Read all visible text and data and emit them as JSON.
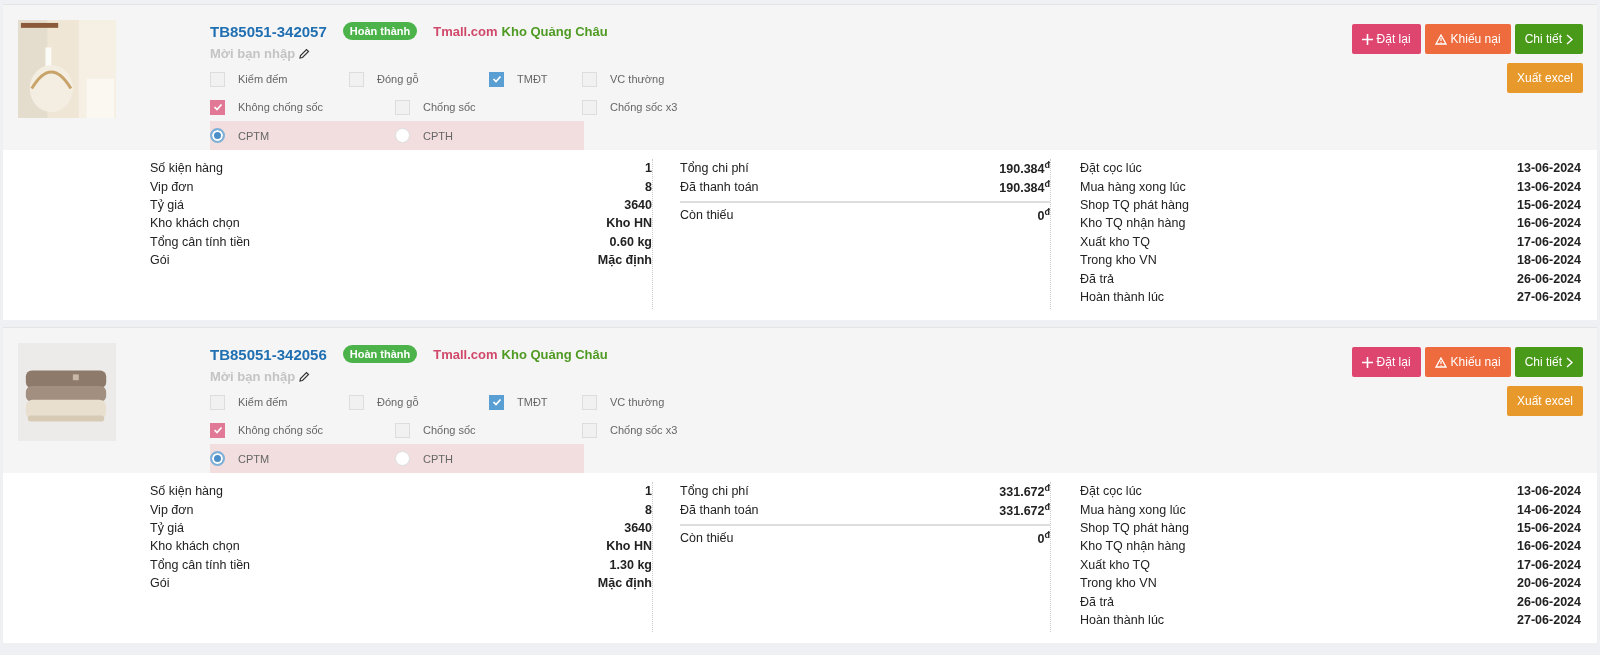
{
  "orders": [
    {
      "code": "TB85051-342057",
      "status": "Hoàn thành",
      "source": "Tmall.com",
      "warehouse": "Kho Quảng Châu",
      "note_placeholder": "Mời bạn nhập",
      "picture": {
        "kind": "picture"
      },
      "option_rows": [
        [
          {
            "label": "Kiểm đếm",
            "checked": false
          },
          {
            "label": "Đóng gỗ",
            "checked": false
          },
          {
            "label": "TMĐT",
            "checked": true
          },
          {
            "label": "VC thường",
            "checked": false
          }
        ],
        [
          {
            "label": "Không chống sốc",
            "checked": true
          },
          {
            "label": "Chống sốc",
            "checked": false
          },
          {
            "label": "Chống sốc x3",
            "checked": false
          }
        ]
      ],
      "shipping": [
        {
          "label": "CPTM",
          "selected": true
        },
        {
          "label": "CPTH",
          "selected": false
        }
      ],
      "buttons": [
        {
          "label": "Đặt lại",
          "kind": "reorder"
        },
        {
          "label": "Khiếu nại",
          "kind": "complaint"
        },
        {
          "label": "Chi tiết",
          "kind": "detail"
        },
        {
          "label": "Xuất excel",
          "kind": "export"
        }
      ],
      "summary": [
        {
          "label": "Số kiện hàng",
          "value": "1"
        },
        {
          "label": "Vip đơn",
          "value": "8"
        },
        {
          "label": "Tỷ giá",
          "value": "3640"
        },
        {
          "label": "Kho khách chọn",
          "value": "Kho HN"
        },
        {
          "label": "Tổng cân tính tiền",
          "value": "0.60 kg"
        },
        {
          "label": "Gói",
          "value": "Mặc định"
        }
      ],
      "costs": [
        {
          "label": "Tổng chi phí",
          "value": "190.384$^{đ}$"
        },
        {
          "label": "Đã thanh toán",
          "value": "190.384$^{đ}$"
        }
      ],
      "balance": {
        "label": "Còn thiếu",
        "value": "0$^{đ}$"
      },
      "timeline": [
        {
          "label": "Đặt cọc lúc",
          "date": "13-06-2024"
        },
        {
          "label": "Mua hàng xong lúc",
          "date": "13-06-2024"
        },
        {
          "label": "Shop TQ phát hàng",
          "date": "15-06-2024"
        },
        {
          "label": "Kho TQ nhận hàng",
          "date": "16-06-2024"
        },
        {
          "label": "Xuất kho TQ",
          "date": "17-06-2024"
        },
        {
          "label": "Trong kho VN",
          "date": "18-06-2024"
        },
        {
          "label": "Đã trả",
          "date": "26-06-2024"
        },
        {
          "label": "Hoàn thành lúc",
          "date": "27-06-2024"
        }
      ]
    },
    {
      "code": "TB85051-342056",
      "status": "Hoàn thành",
      "source": "Tmall.com",
      "warehouse": "Kho Quảng Châu",
      "note_placeholder": "Mời bạn nhập",
      "picture": {
        "kind": "picture"
      },
      "option_rows": [
        [
          {
            "label": "Kiểm đếm",
            "checked": false
          },
          {
            "label": "Đóng gỗ",
            "checked": false
          },
          {
            "label": "TMĐT",
            "checked": true
          },
          {
            "label": "VC thường",
            "checked": false
          }
        ],
        [
          {
            "label": "Không chống sốc",
            "checked": true
          },
          {
            "label": "Chống sốc",
            "checked": false
          },
          {
            "label": "Chống sốc x3",
            "checked": false
          }
        ]
      ],
      "shipping": [
        {
          "label": "CPTM",
          "selected": true
        },
        {
          "label": "CPTH",
          "selected": false
        }
      ],
      "buttons": [
        {
          "label": "Đặt lại",
          "kind": "reorder"
        },
        {
          "label": "Khiếu nại",
          "kind": "complaint"
        },
        {
          "label": "Chi tiết",
          "kind": "detail"
        },
        {
          "label": "Xuất excel",
          "kind": "export"
        }
      ],
      "summary": [
        {
          "label": "Số kiện hàng",
          "value": "1"
        },
        {
          "label": "Vip đơn",
          "value": "8"
        },
        {
          "label": "Tỷ giá",
          "value": "3640"
        },
        {
          "label": "Kho khách chọn",
          "value": "Kho HN"
        },
        {
          "label": "Tổng cân tính tiền",
          "value": "1.30 kg"
        },
        {
          "label": "Gói",
          "value": "Mặc định"
        }
      ],
      "costs": [
        {
          "label": "Tổng chi phí",
          "value": "331.672$^{đ}$"
        },
        {
          "label": "Đã thanh toán",
          "value": "331.672$^{đ}$"
        }
      ],
      "balance": {
        "label": "Còn thiếu",
        "value": "0$^{đ}$"
      },
      "timeline": [
        {
          "label": "Đặt cọc lúc",
          "date": "13-06-2024"
        },
        {
          "label": "Mua hàng xong lúc",
          "date": "14-06-2024"
        },
        {
          "label": "Shop TQ phát hàng",
          "date": "15-06-2024"
        },
        {
          "label": "Kho TQ nhận hàng",
          "date": "16-06-2024"
        },
        {
          "label": "Xuất kho TQ",
          "date": "17-06-2024"
        },
        {
          "label": "Trong kho VN",
          "date": "20-06-2024"
        },
        {
          "label": "Đã trả",
          "date": "26-06-2024"
        },
        {
          "label": "Hoàn thành lúc",
          "date": "27-06-2024"
        }
      ]
    }
  ]
}
